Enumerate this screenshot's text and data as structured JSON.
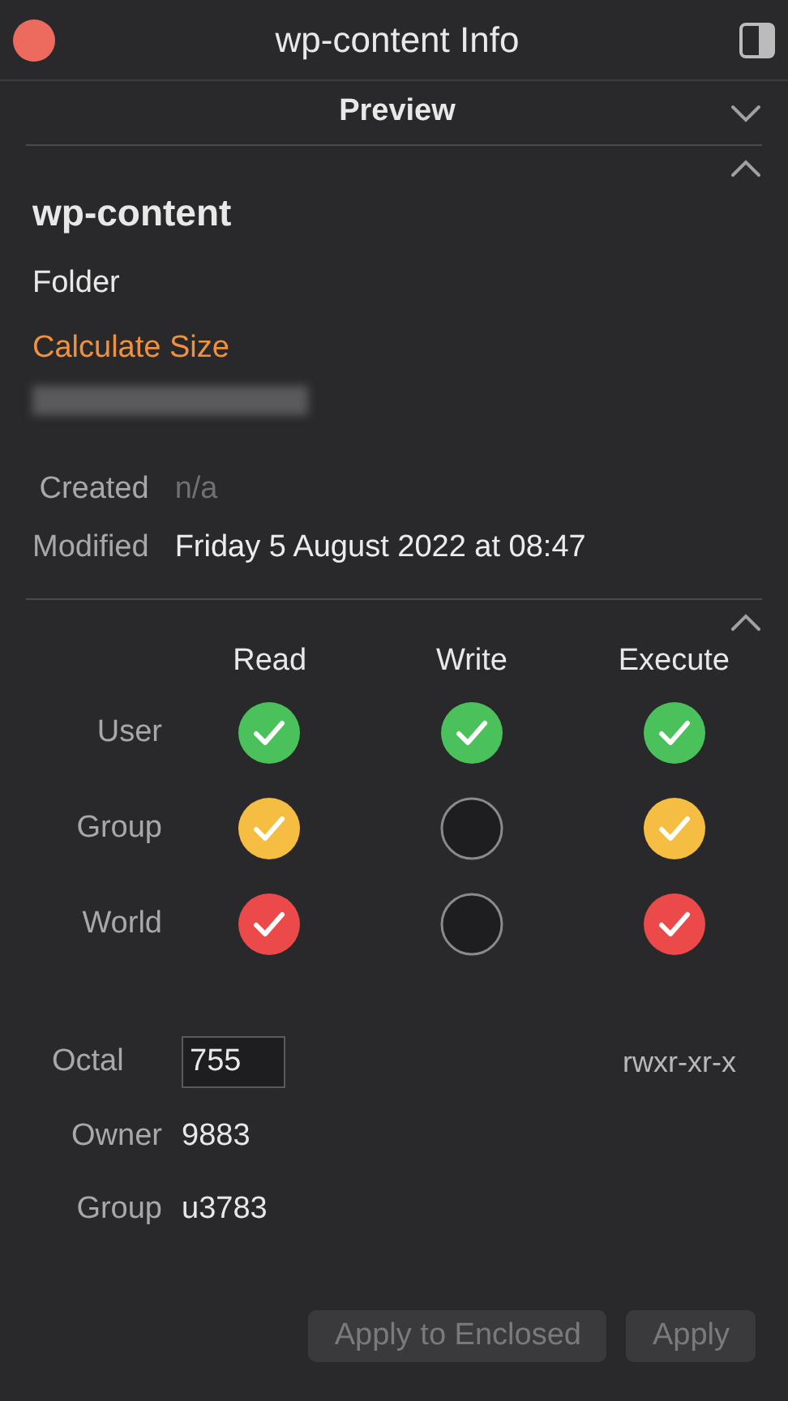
{
  "window": {
    "title": "wp-content Info"
  },
  "preview": {
    "label": "Preview",
    "expanded": false
  },
  "general": {
    "expanded": true,
    "name": "wp-content",
    "kind": "Folder",
    "link": "Calculate Size",
    "dates": [
      {
        "label": "Created",
        "value": "n/a",
        "available": false
      },
      {
        "label": "Modified",
        "value": "Friday 5 August 2022 at 08:47",
        "available": true
      }
    ]
  },
  "permissions": {
    "expanded": true,
    "columns": [
      "Read",
      "Write",
      "Execute"
    ],
    "rows": [
      {
        "label": "User",
        "cells": [
          {
            "checked": true,
            "color": "#4ac15a"
          },
          {
            "checked": true,
            "color": "#4ac15a"
          },
          {
            "checked": true,
            "color": "#4ac15a"
          }
        ]
      },
      {
        "label": "Group",
        "cells": [
          {
            "checked": true,
            "color": "#f5bd42"
          },
          {
            "checked": false
          },
          {
            "checked": true,
            "color": "#f5bd42"
          }
        ]
      },
      {
        "label": "World",
        "cells": [
          {
            "checked": true,
            "color": "#ec4a4a"
          },
          {
            "checked": false
          },
          {
            "checked": true,
            "color": "#ec4a4a"
          }
        ]
      }
    ],
    "octal_label": "Octal",
    "octal": "755",
    "symbolic": "rwxr-xr-x",
    "owner_label": "Owner",
    "owner": "9883",
    "group_label": "Group",
    "group": "u3783"
  },
  "buttons": [
    {
      "label": "Apply to Enclosed",
      "disabled": true
    },
    {
      "label": "Apply",
      "disabled": true
    }
  ]
}
